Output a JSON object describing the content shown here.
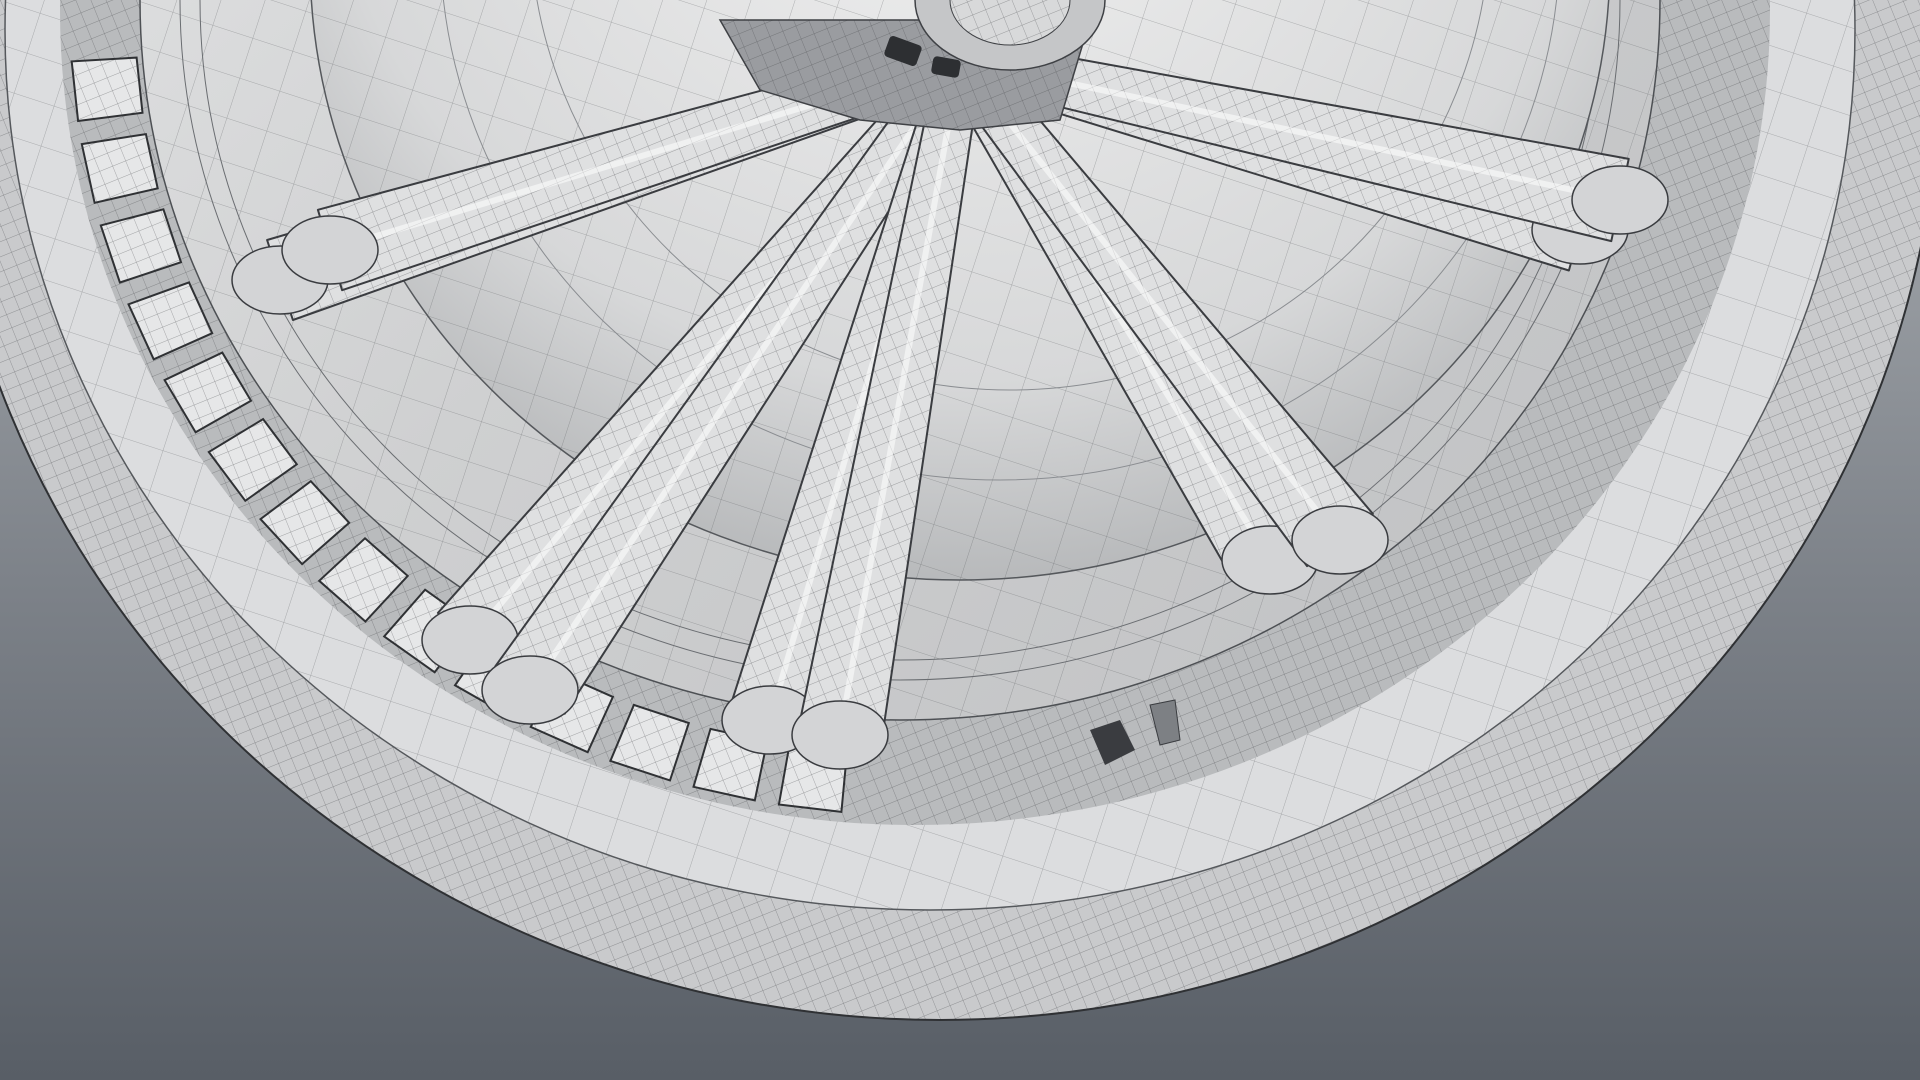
{
  "viewport": {
    "background_top": "#adb1b5",
    "background_bottom": "#5a6068"
  },
  "model": {
    "surface_color": "#d9dadb",
    "shadow_color": "#8f9295",
    "wire_color": "#3c3e41",
    "spoke_count": 10,
    "vent_count": 14
  }
}
